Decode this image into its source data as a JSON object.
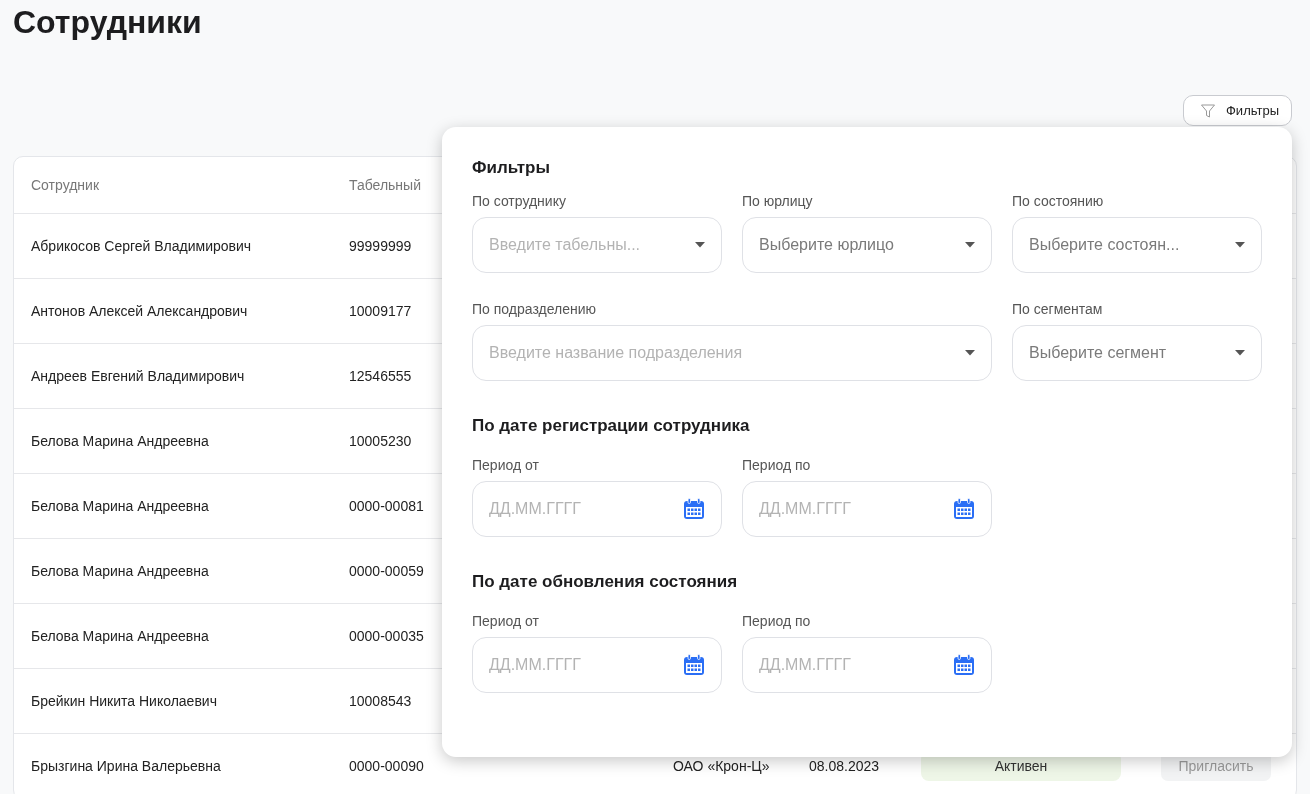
{
  "page": {
    "title": "Сотрудники"
  },
  "filter_button": {
    "label": "Фильтры"
  },
  "table": {
    "columns": [
      "Сотрудник",
      "Табельный"
    ],
    "rows": [
      {
        "employee": "Абрикосов Сергей Владимирович",
        "number": "99999999"
      },
      {
        "employee": "Антонов Алексей Александрович",
        "number": "10009177"
      },
      {
        "employee": "Андреев Евгений Владимирович",
        "number": "12546555"
      },
      {
        "employee": "Белова Марина Андреевна",
        "number": "10005230"
      },
      {
        "employee": "Белова Марина Андреевна",
        "number": "0000-00081"
      },
      {
        "employee": "Белова Марина Андреевна",
        "number": "0000-00059"
      },
      {
        "employee": "Белова Марина Андреевна",
        "number": "0000-00035"
      },
      {
        "employee": "Брейкин Никита Николаевич",
        "number": "10008543"
      },
      {
        "employee": "Брызгина Ирина Валерьевна",
        "number": "0000-00090",
        "legal_entity": "ОАО «Крон-Ц»",
        "date": "08.08.2023",
        "status": "Активен",
        "action": {
          "label": "Пригласить",
          "disabled": true
        }
      }
    ]
  },
  "filters": {
    "sections": [
      {
        "heading": "Фильтры",
        "rows": [
          [
            {
              "label": "По сотруднику",
              "kind": "text",
              "placeholder": "Введите табельны..."
            },
            {
              "label": "По юрлицу",
              "kind": "select",
              "placeholder": "Выберите юрлицо"
            },
            {
              "label": "По состоянию",
              "kind": "select",
              "placeholder": "Выберите состоян..."
            }
          ],
          [
            {
              "label": "По подразделению",
              "kind": "text",
              "placeholder": "Введите название подразделения"
            },
            "",
            {
              "label": "По сегментам",
              "kind": "select",
              "placeholder": "Выберите сегмент"
            }
          ]
        ]
      },
      {
        "heading": "По дате регистрации сотрудника",
        "rows": [
          [
            {
              "label": "Период от",
              "kind": "date",
              "placeholder": "ДД.ММ.ГГГГ"
            },
            {
              "label": "Период по",
              "kind": "date",
              "placeholder": "ДД.ММ.ГГГГ"
            }
          ]
        ]
      },
      {
        "heading": "По дате обновления состояния",
        "rows": [
          [
            {
              "label": "Период от",
              "kind": "date",
              "placeholder": "ДД.ММ.ГГГГ"
            },
            {
              "label": "Период по",
              "kind": "date",
              "placeholder": "ДД.ММ.ГГГГ"
            }
          ]
        ]
      }
    ]
  }
}
